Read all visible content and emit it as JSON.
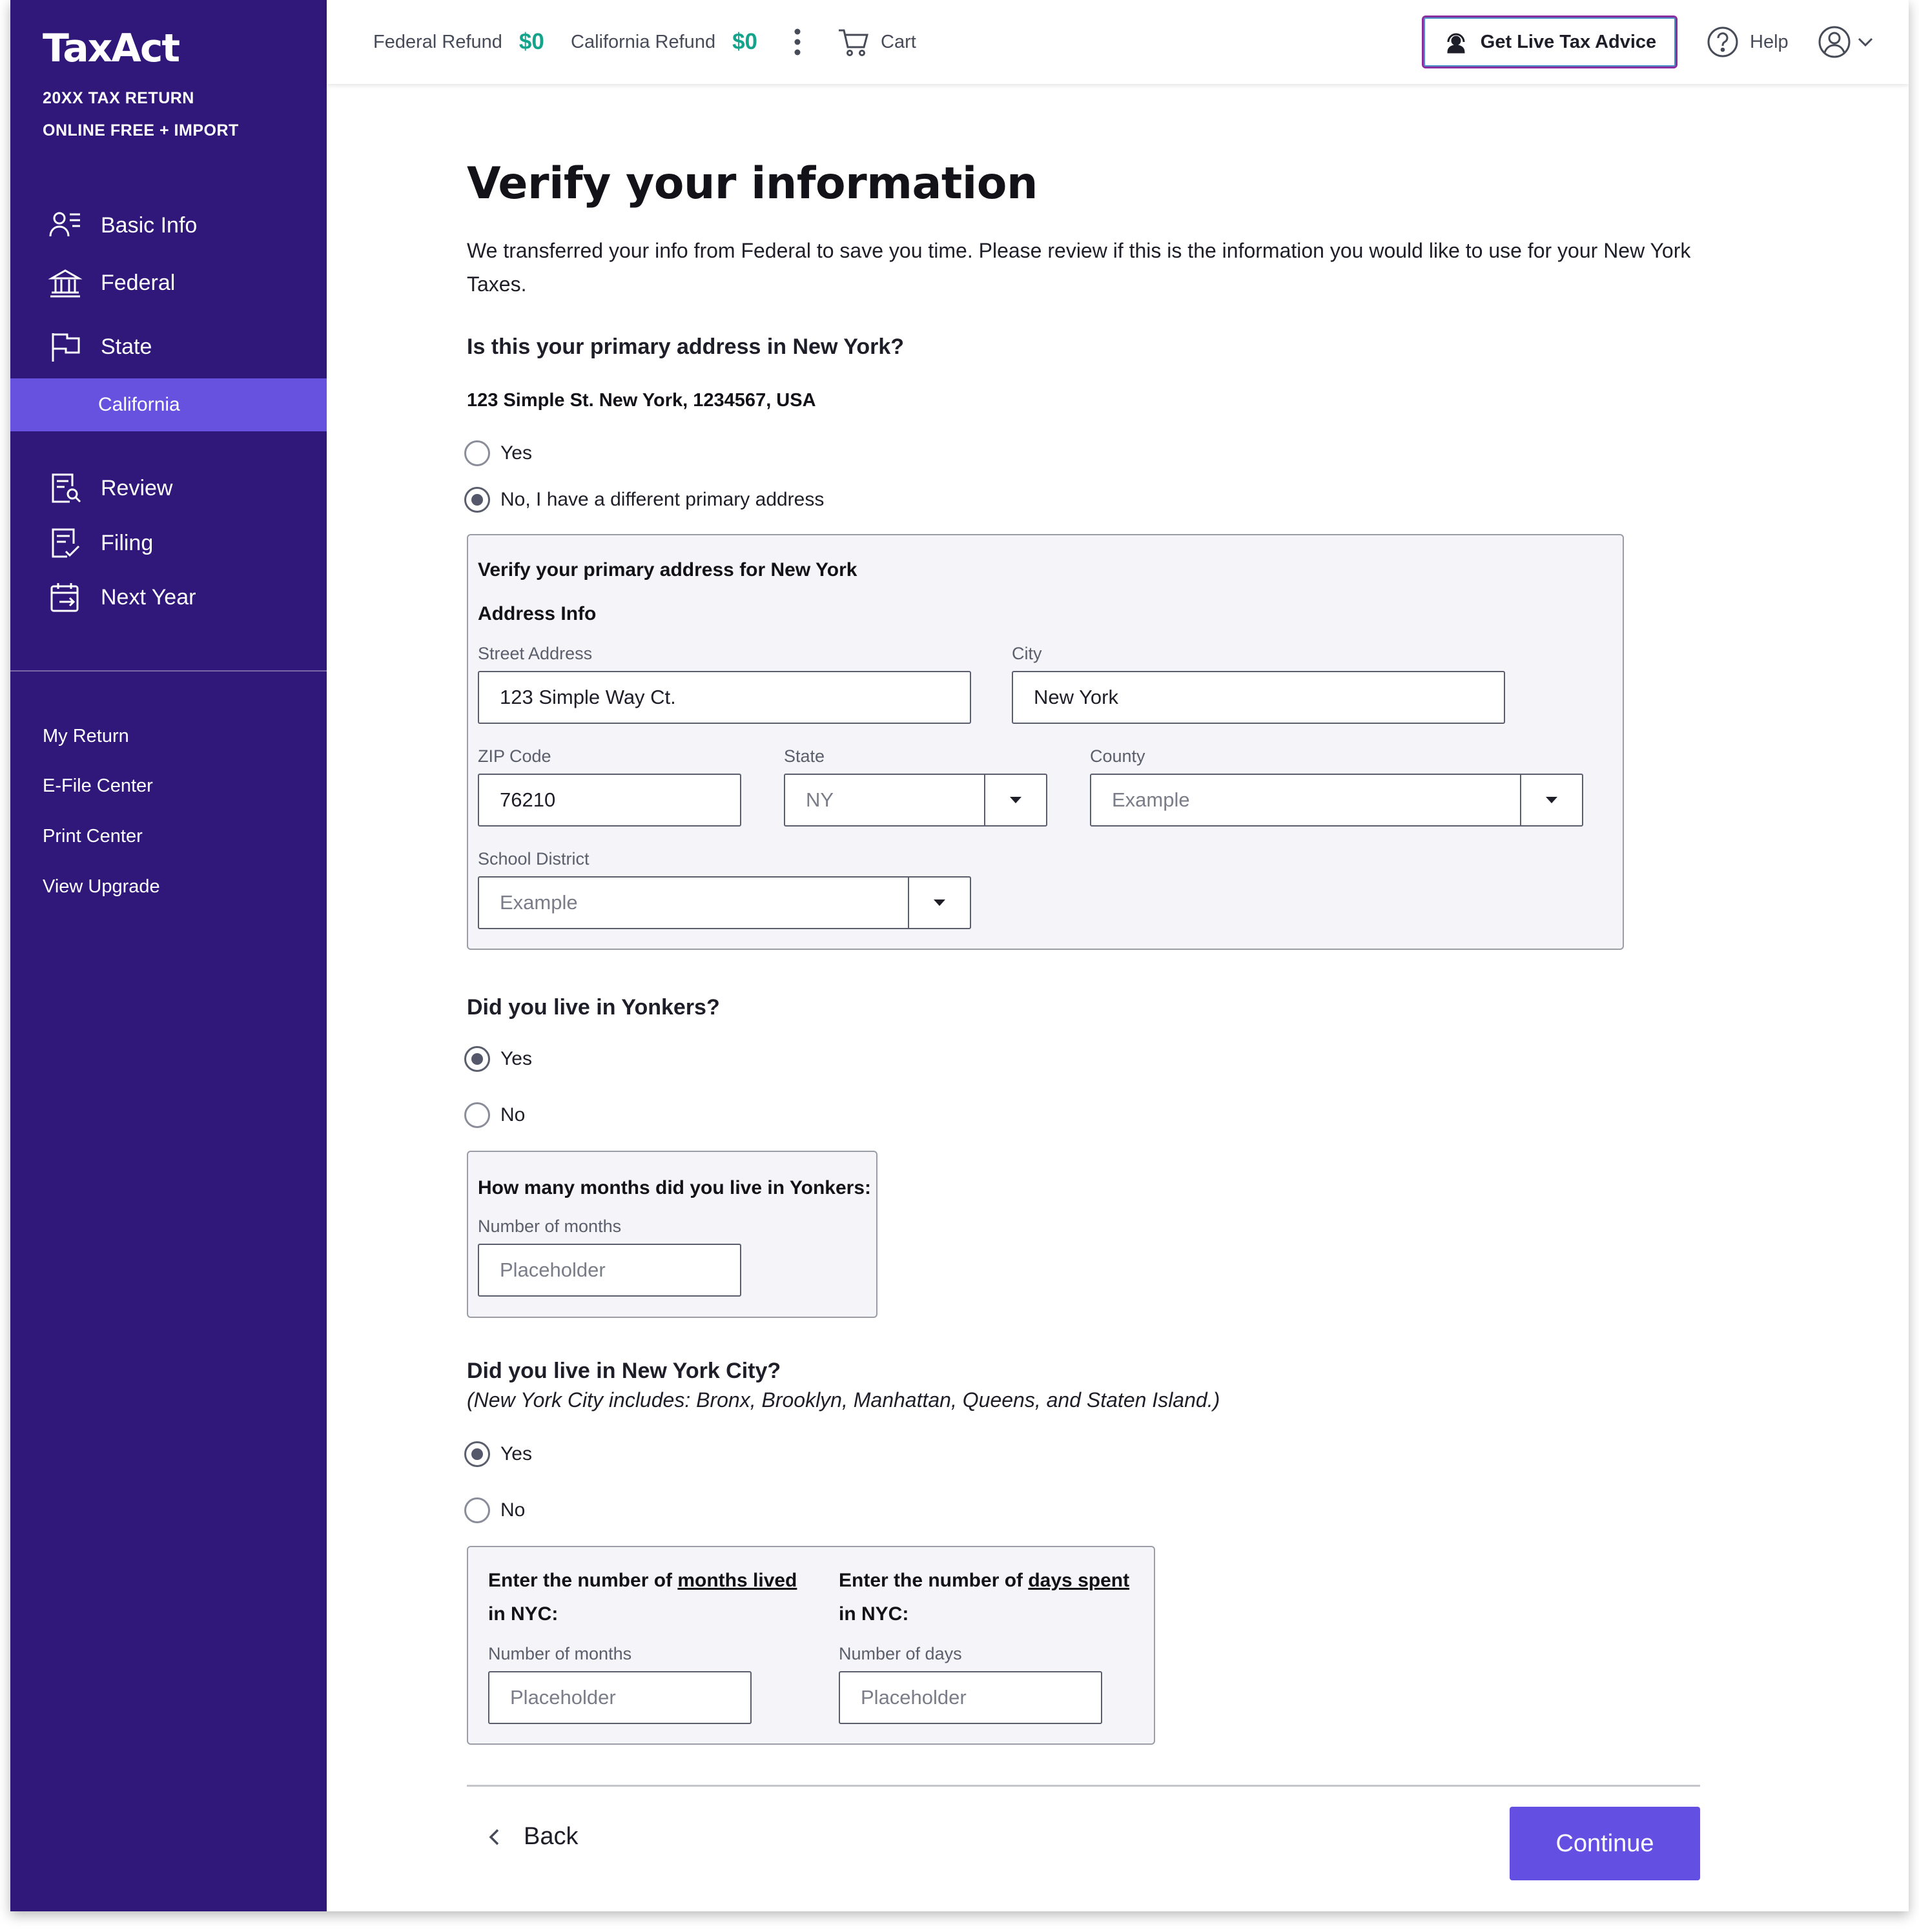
{
  "brand": {
    "logo": "TaxAct",
    "line1": "20XX TAX RETURN",
    "line2": "ONLINE FREE + IMPORT"
  },
  "sidebar": {
    "nav": [
      {
        "label": "Basic Info",
        "icon": "person-list-icon"
      },
      {
        "label": "Federal",
        "icon": "building-icon"
      },
      {
        "label": "State",
        "icon": "flag-icon"
      },
      {
        "label": "Review",
        "icon": "document-search-icon"
      },
      {
        "label": "Filing",
        "icon": "document-check-icon"
      },
      {
        "label": "Next Year",
        "icon": "calendar-arrow-icon"
      }
    ],
    "active_sub": "California",
    "links": [
      "My Return",
      "E-File Center",
      "Print Center",
      "View Upgrade"
    ]
  },
  "topbar": {
    "federal_label": "Federal Refund",
    "federal_amount": "$0",
    "california_label": "California Refund",
    "california_amount": "$0",
    "cart_label": "Cart",
    "advice_label": "Get Live Tax Advice",
    "help_label": "Help"
  },
  "main": {
    "title": "Verify your information",
    "intro": "We transferred your info from Federal to save you time. Please review if this is the information you would like to use for your New York Taxes.",
    "q1": {
      "question": "Is this your primary address in New York?",
      "address": "123 Simple St. New York, 1234567, USA",
      "opt_yes": "Yes",
      "opt_no": "No, I have a different primary address",
      "selected": "no"
    },
    "address_box": {
      "title": "Verify your primary address for New York",
      "section": "Address Info",
      "street_label": "Street Address",
      "street_value": "123 Simple Way Ct.",
      "city_label": "City",
      "city_value": "New York",
      "zip_label": "ZIP Code",
      "zip_value": "76210",
      "state_label": "State",
      "state_value": "NY",
      "county_label": "County",
      "county_value": "Example",
      "school_label": "School District",
      "school_value": "Example"
    },
    "q2": {
      "question": "Did you live in Yonkers?",
      "opt_yes": "Yes",
      "opt_no": "No",
      "selected": "yes",
      "box_title": "How many months did you live in Yonkers:",
      "months_label": "Number of months",
      "months_placeholder": "Placeholder"
    },
    "q3": {
      "question": "Did you live in New York City?",
      "note": "(New York City includes: Bronx, Brooklyn, Manhattan, Queens, and Staten Island.)",
      "opt_yes": "Yes",
      "opt_no": "No",
      "selected": "yes",
      "months_prefix": "Enter the number of ",
      "months_emph": "months lived",
      "months_suffix": "in NYC:",
      "days_prefix": "Enter the number of ",
      "days_emph": "days spent",
      "days_suffix": "in NYC:",
      "months_label": "Number of months",
      "days_label": "Number of days",
      "months_placeholder": "Placeholder",
      "days_placeholder": "Placeholder"
    },
    "back_label": "Back",
    "continue_label": "Continue"
  },
  "colors": {
    "sidebar": "#30177a",
    "sidebar_active": "#6752e0",
    "refund_green": "#14a38b",
    "primary_button": "#6350e3"
  }
}
